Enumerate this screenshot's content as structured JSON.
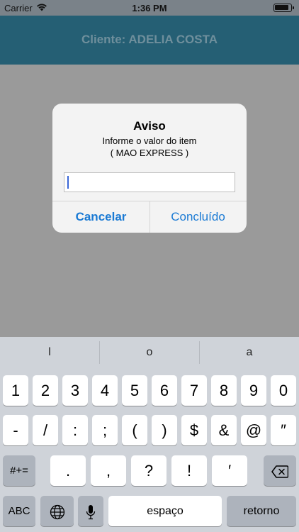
{
  "status_bar": {
    "carrier": "Carrier",
    "time": "1:36 PM",
    "battery_level": 0.9
  },
  "nav": {
    "title": "Cliente: ADELIA COSTA"
  },
  "alert": {
    "title": "Aviso",
    "message_line1": "Informe o valor do item",
    "message_line2": "( MAO EXPRESS )",
    "input_value": "",
    "cancel_label": "Cancelar",
    "done_label": "Concluído"
  },
  "keyboard": {
    "suggestions": [
      "l",
      "o",
      "a"
    ],
    "row1": [
      "1",
      "2",
      "3",
      "4",
      "5",
      "6",
      "7",
      "8",
      "9",
      "0"
    ],
    "row2": [
      "-",
      "/",
      ":",
      ";",
      "(",
      ")",
      "$",
      "&",
      "@",
      "″"
    ],
    "row3": [
      "#+=",
      ".",
      ",",
      "?",
      "!",
      "′"
    ],
    "bottom": {
      "abc": "ABC",
      "space": "espaço",
      "return": "retorno"
    },
    "icons": [
      "globe-icon",
      "microphone-icon",
      "backspace-icon"
    ]
  },
  "colors": {
    "nav_bg": "#255f74",
    "accent": "#1a7ad4",
    "cursor": "#3a66d6"
  }
}
